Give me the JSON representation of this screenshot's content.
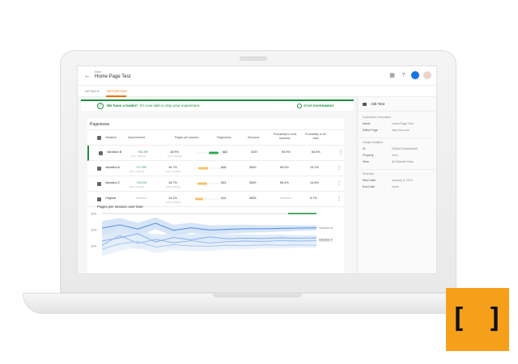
{
  "header": {
    "breadcrumb": "New",
    "title": "Home Page Test",
    "icons": [
      "apps-icon",
      "help-icon",
      "account-icon",
      "avatar"
    ]
  },
  "tabs": [
    {
      "label": "DETAILS",
      "active": false
    },
    {
      "label": "REPORTING",
      "active": true
    }
  ],
  "banner": {
    "lead": "We have a leader!",
    "text": "It's now safe to stop your experiment.",
    "stop_label": "STOP EXPERIMENT",
    "color": "#1e8e3e"
  },
  "report": {
    "title": "Pageviews",
    "columns": {
      "variation": "Variation",
      "improvement": "Improvement",
      "pps": "Pages per session",
      "pageviews": "Pageviews",
      "sessions": "Sessions",
      "prob_baseline": "Probability to beat baseline",
      "prob_best": "Probability to be best"
    },
    "rows": [
      {
        "name": "Variation B",
        "improvement": "+30.4%",
        "imp_range": "(21.1, 35.6%)",
        "pps": "18.9%",
        "pps_range": "(17.9, 19.3%)",
        "pageviews": "682",
        "sessions": "3437",
        "prob_baseline": "99.9%",
        "prob_best": "64.5%",
        "leader": true
      },
      {
        "name": "Variation A",
        "improvement": "+17.9%",
        "imp_range": "(16.7, 18.4%)",
        "pps": "16.7%",
        "pps_range": "(15.4, 16.9%)",
        "pageviews": "608",
        "sessions": "3649",
        "prob_baseline": "69.9%",
        "prob_best": "13.1%",
        "leader": false
      },
      {
        "name": "Variation C",
        "improvement": "+13.1%",
        "imp_range": "(15.4, 14.0%)",
        "pps": "16.7%",
        "pps_range": "(15.8, 18.1%)",
        "pageviews": "593",
        "sessions": "3549",
        "prob_baseline": "56.4%",
        "prob_best": "14.6%",
        "leader": false
      },
      {
        "name": "Original",
        "improvement": "baseline",
        "imp_range": "",
        "pps": "14.2%",
        "pps_range": "(13.8, 14.5%)",
        "pageviews": "514",
        "sessions": "3605",
        "prob_baseline": "baseline",
        "prob_best": "5.7%",
        "leader": false
      }
    ]
  },
  "chart_data": {
    "type": "line",
    "title": "Pages per session over time",
    "ylim": [
      0,
      20
    ],
    "yticks": [
      "20%",
      "15%",
      "10%"
    ],
    "series": [
      {
        "name": "Variation B",
        "values": [
          15.5,
          16.5,
          15.2,
          17.0,
          14.8,
          15.6,
          14.9,
          15.1,
          15.3,
          15.3,
          15.4,
          15.5,
          15.6
        ]
      },
      {
        "name": "Variation A",
        "values": [
          11.5,
          12.5,
          13.8,
          11.2,
          12.6,
          11.9,
          12.8,
          12.2,
          12.4,
          12.3,
          12.5,
          12.4,
          12.5
        ]
      },
      {
        "name": "Variation C",
        "values": [
          10.2,
          13.2,
          10.8,
          12.0,
          11.0,
          11.6,
          10.9,
          11.3,
          11.5,
          11.4,
          11.6,
          11.5,
          11.6
        ]
      },
      {
        "name": "Original",
        "values": [
          9.0,
          10.6,
          11.4,
          9.6,
          10.4,
          10.0,
          9.9,
          10.2,
          10.1,
          10.3,
          10.2,
          10.3,
          10.2
        ]
      }
    ],
    "grid": true
  },
  "sidebar": {
    "title": "A/B Test",
    "sections": [
      {
        "heading": "Experiment Information",
        "items": [
          {
            "k": "Name",
            "v": "Home Page Test"
          },
          {
            "k": "Editor Page",
            "v": "http://xxx.com"
          }
        ]
      },
      {
        "heading": "Google Analytics",
        "items": [
          {
            "k": "ID",
            "v": "D06fa714e8a0d695"
          },
          {
            "k": "Property",
            "v": "Xxxx"
          },
          {
            "k": "View",
            "v": "All Website Data"
          }
        ]
      },
      {
        "heading": "Schedule",
        "items": [
          {
            "k": "Start Date",
            "v": "January 8, 2015"
          },
          {
            "k": "End Date",
            "v": "None"
          }
        ]
      }
    ]
  },
  "colors": {
    "accent_tab": "#e8710a",
    "success": "#1e8e3e",
    "account": "#1a73e8",
    "logo": "#f5a01a"
  }
}
